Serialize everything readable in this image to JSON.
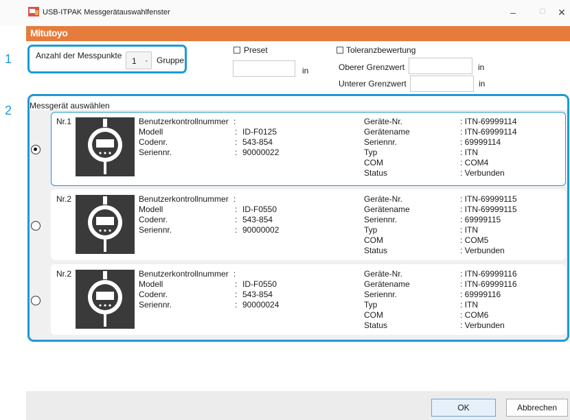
{
  "window": {
    "title": "USB-ITPAK Messgerätauswahlfenster",
    "brand": "Mitutoyo",
    "minimize": "–",
    "maximize": "☐",
    "close": "✕"
  },
  "callouts": {
    "one": "1",
    "two": "2"
  },
  "points": {
    "label": "Anzahl der Messpunkte",
    "selected": "1",
    "group_label": "Gruppe"
  },
  "preset": {
    "label": "Preset",
    "checked": false,
    "value": "",
    "unit": "in"
  },
  "tolerance": {
    "label": "Toleranzbewertung",
    "checked": false,
    "upper_label": "Oberer Grenzwert",
    "upper_value": "",
    "upper_unit": "in",
    "lower_label": "Unterer Grenzwert",
    "lower_value": "",
    "lower_unit": "in"
  },
  "devices_section": {
    "title": "Messgerät auswählen",
    "devices": [
      {
        "nr": "Nr.1",
        "selected": true,
        "left": [
          {
            "k": "Benutzerkontrollnummer",
            "v": ""
          },
          {
            "k": "Modell",
            "v": "ID-F0125"
          },
          {
            "k": "Codenr.",
            "v": "543-854"
          },
          {
            "k": "Seriennr.",
            "v": "90000022"
          }
        ],
        "right": [
          {
            "k": "Geräte-Nr.",
            "v": ": ITN-69999114"
          },
          {
            "k": "Gerätename",
            "v": ": ITN-69999114"
          },
          {
            "k": "Seriennr.",
            "v": ": 69999114"
          },
          {
            "k": "Typ",
            "v": ": ITN"
          },
          {
            "k": "COM",
            "v": ": COM4"
          },
          {
            "k": "Status",
            "v": ": Verbunden"
          }
        ]
      },
      {
        "nr": "Nr.2",
        "selected": false,
        "left": [
          {
            "k": "Benutzerkontrollnummer",
            "v": ""
          },
          {
            "k": "Modell",
            "v": "ID-F0550"
          },
          {
            "k": "Codenr.",
            "v": "543-854"
          },
          {
            "k": "Seriennr.",
            "v": "90000002"
          }
        ],
        "right": [
          {
            "k": "Geräte-Nr.",
            "v": ": ITN-69999115"
          },
          {
            "k": "Gerätename",
            "v": ": ITN-69999115"
          },
          {
            "k": "Seriennr.",
            "v": ": 69999115"
          },
          {
            "k": "Typ",
            "v": ": ITN"
          },
          {
            "k": "COM",
            "v": ": COM5"
          },
          {
            "k": "Status",
            "v": ": Verbunden"
          }
        ]
      },
      {
        "nr": "Nr.2",
        "selected": false,
        "left": [
          {
            "k": "Benutzerkontrollnummer",
            "v": ""
          },
          {
            "k": "Modell",
            "v": "ID-F0550"
          },
          {
            "k": "Codenr.",
            "v": "543-854"
          },
          {
            "k": "Seriennr.",
            "v": "90000024"
          }
        ],
        "right": [
          {
            "k": "Geräte-Nr.",
            "v": ": ITN-69999116"
          },
          {
            "k": "Gerätename",
            "v": ": ITN-69999116"
          },
          {
            "k": "Seriennr.",
            "v": ": 69999116"
          },
          {
            "k": "Typ",
            "v": ": ITN"
          },
          {
            "k": "COM",
            "v": ": COM6"
          },
          {
            "k": "Status",
            "v": ": Verbunden"
          }
        ]
      }
    ]
  },
  "footer": {
    "ok": "OK",
    "cancel": "Abbrechen"
  },
  "colors": {
    "brand": "#e67c3b",
    "callout": "#1a9ad6"
  }
}
